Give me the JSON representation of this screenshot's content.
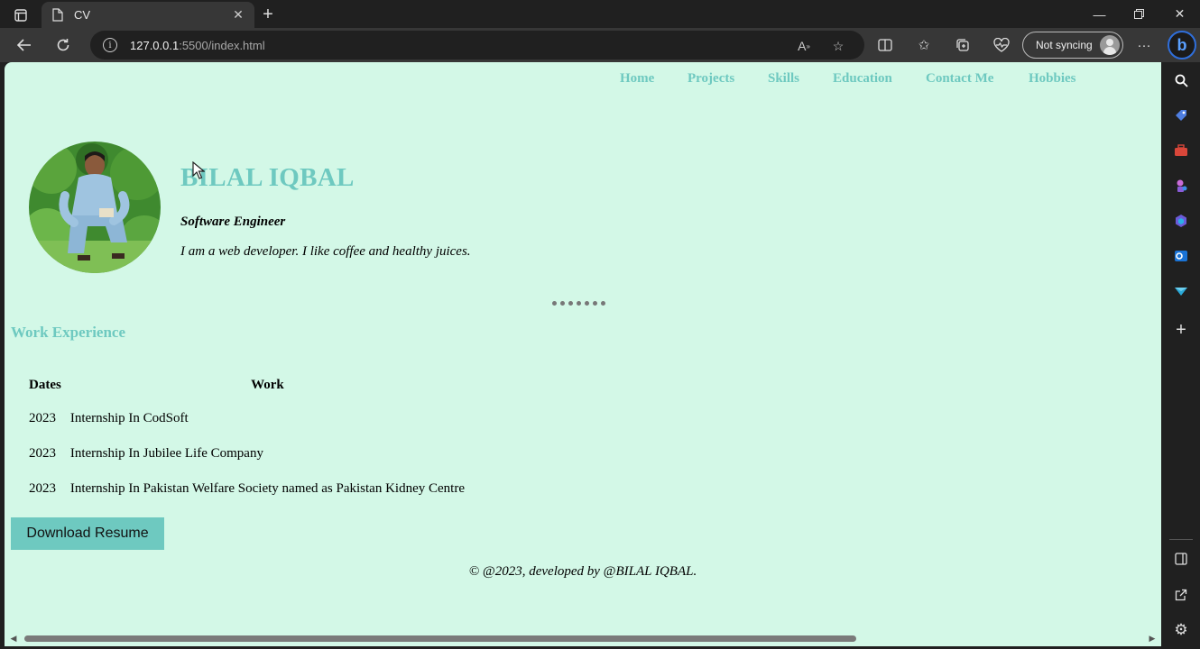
{
  "browser": {
    "tab_title": "CV",
    "url_host": "127.0.0.1",
    "url_rest": ":5500/index.html",
    "sync_label": "Not syncing"
  },
  "page": {
    "nav": [
      "Home",
      "Projects",
      "Skills",
      "Education",
      "Contact Me",
      "Hobbies"
    ],
    "name": "BILAL IQBAL",
    "role": "Software Engineer",
    "bio": "I am a web developer. I like coffee and healthy juices.",
    "section_title": "Work Experience",
    "table": {
      "headers": [
        "Dates",
        "Work"
      ],
      "rows": [
        [
          "2023",
          "Internship In CodSoft"
        ],
        [
          "2023",
          "Internship In Jubilee Life Company"
        ],
        [
          "2023",
          "Internship In Pakistan Welfare Society named as Pakistan Kidney Centre"
        ]
      ]
    },
    "download_label": "Download Resume",
    "footer": "© @2023, developed by @BILAL IQBAL."
  },
  "colors": {
    "page_bg": "#d3f8e7",
    "accent": "#6ec9c0",
    "browser_chrome": "#202020"
  }
}
